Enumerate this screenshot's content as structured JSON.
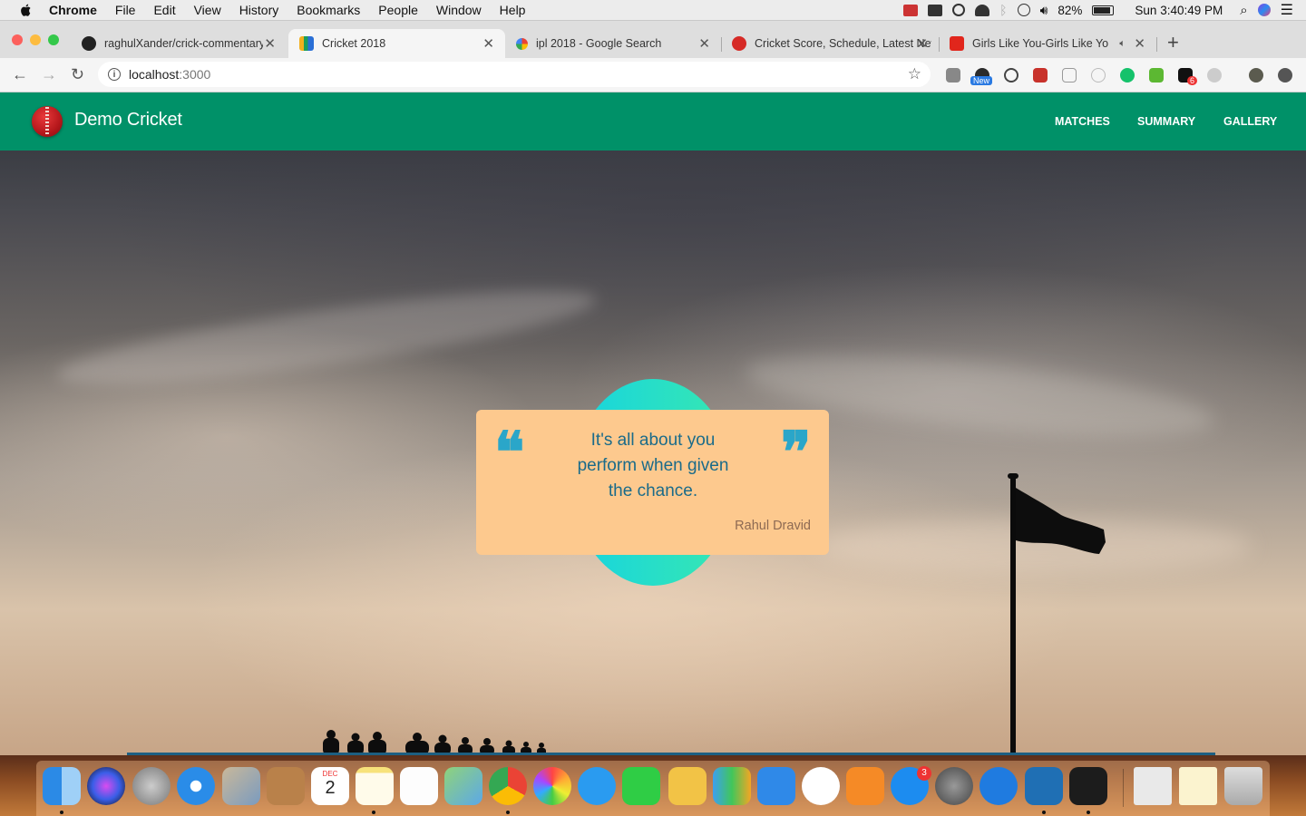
{
  "menubar": {
    "app_name": "Chrome",
    "items": [
      "File",
      "Edit",
      "View",
      "History",
      "Bookmarks",
      "People",
      "Window",
      "Help"
    ],
    "battery": "82%",
    "clock": "Sun 3:40:49 PM"
  },
  "tabs": [
    {
      "title": "raghulXander/crick-commentary",
      "favicon": "github-icon",
      "active": false
    },
    {
      "title": "Cricket 2018",
      "favicon": "chart-icon",
      "active": true
    },
    {
      "title": "ipl 2018 - Google Search",
      "favicon": "google-icon",
      "active": false
    },
    {
      "title": "Cricket Score, Schedule, Latest News",
      "favicon": "cricbuzz-icon",
      "active": false
    },
    {
      "title": "Girls Like You-Girls Like You",
      "favicon": "gaana-icon",
      "active": false,
      "audio": true
    }
  ],
  "address_bar": {
    "host": "localhost",
    "port": ":3000"
  },
  "extensions": {
    "new_badge": "New",
    "count_badge": "6"
  },
  "site": {
    "brand": "Demo Cricket",
    "nav": [
      "MATCHES",
      "SUMMARY",
      "GALLERY"
    ],
    "quote": {
      "text": "It's all about you perform when given the chance.",
      "author": "Rahul Dravid"
    }
  },
  "dock": {
    "app_store_badge": "3",
    "calendar_month": "DEC",
    "calendar_day": "2"
  },
  "colors": {
    "navbar": "#009168",
    "quote_card": "#fdc98e",
    "quote_text": "#1a6b8a",
    "quote_marks": "#2aa6c9",
    "blob_start": "#16d4e0",
    "blob_end": "#38e8b0"
  }
}
